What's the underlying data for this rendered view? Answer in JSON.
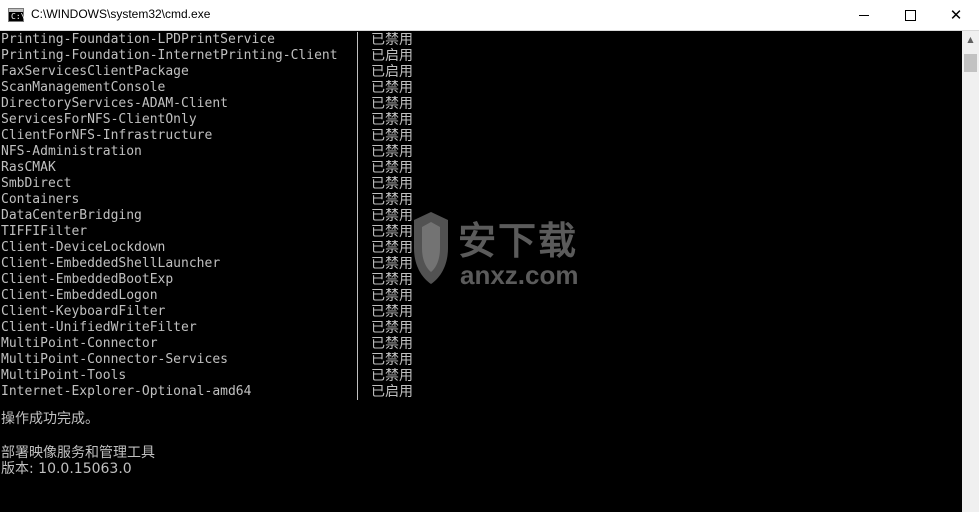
{
  "window": {
    "title": "C:\\WINDOWS\\system32\\cmd.exe",
    "icon_label": "C:\\",
    "icon": "cmd-icon",
    "controls": {
      "minimize": "minimize-icon",
      "maximize": "maximize-icon",
      "close": "✕"
    }
  },
  "features": [
    {
      "name": "Printing-Foundation-LPDPrintService",
      "state": "已禁用"
    },
    {
      "name": "Printing-Foundation-InternetPrinting-Client",
      "state": "已启用"
    },
    {
      "name": "FaxServicesClientPackage",
      "state": "已启用"
    },
    {
      "name": "ScanManagementConsole",
      "state": "已禁用"
    },
    {
      "name": "DirectoryServices-ADAM-Client",
      "state": "已禁用"
    },
    {
      "name": "ServicesForNFS-ClientOnly",
      "state": "已禁用"
    },
    {
      "name": "ClientForNFS-Infrastructure",
      "state": "已禁用"
    },
    {
      "name": "NFS-Administration",
      "state": "已禁用"
    },
    {
      "name": "RasCMAK",
      "state": "已禁用"
    },
    {
      "name": "SmbDirect",
      "state": "已禁用"
    },
    {
      "name": "Containers",
      "state": "已禁用"
    },
    {
      "name": "DataCenterBridging",
      "state": "已禁用"
    },
    {
      "name": "TIFFIFilter",
      "state": "已禁用"
    },
    {
      "name": "Client-DeviceLockdown",
      "state": "已禁用"
    },
    {
      "name": "Client-EmbeddedShellLauncher",
      "state": "已禁用"
    },
    {
      "name": "Client-EmbeddedBootExp",
      "state": "已禁用"
    },
    {
      "name": "Client-EmbeddedLogon",
      "state": "已禁用"
    },
    {
      "name": "Client-KeyboardFilter",
      "state": "已禁用"
    },
    {
      "name": "Client-UnifiedWriteFilter",
      "state": "已禁用"
    },
    {
      "name": "MultiPoint-Connector",
      "state": "已禁用"
    },
    {
      "name": "MultiPoint-Connector-Services",
      "state": "已禁用"
    },
    {
      "name": "MultiPoint-Tools",
      "state": "已禁用"
    },
    {
      "name": "Internet-Explorer-Optional-amd64",
      "state": "已启用"
    }
  ],
  "messages": {
    "success": "操作成功完成。",
    "tool_name": "部署映像服务和管理工具",
    "version": "版本: 10.0.15063.0"
  },
  "watermark": {
    "cn": "安下载",
    "en": "anxz.com",
    "icon": "shield-icon"
  },
  "colors": {
    "console_bg": "#000000",
    "console_fg": "#c0c0c0",
    "titlebar_bg": "#ffffff"
  }
}
